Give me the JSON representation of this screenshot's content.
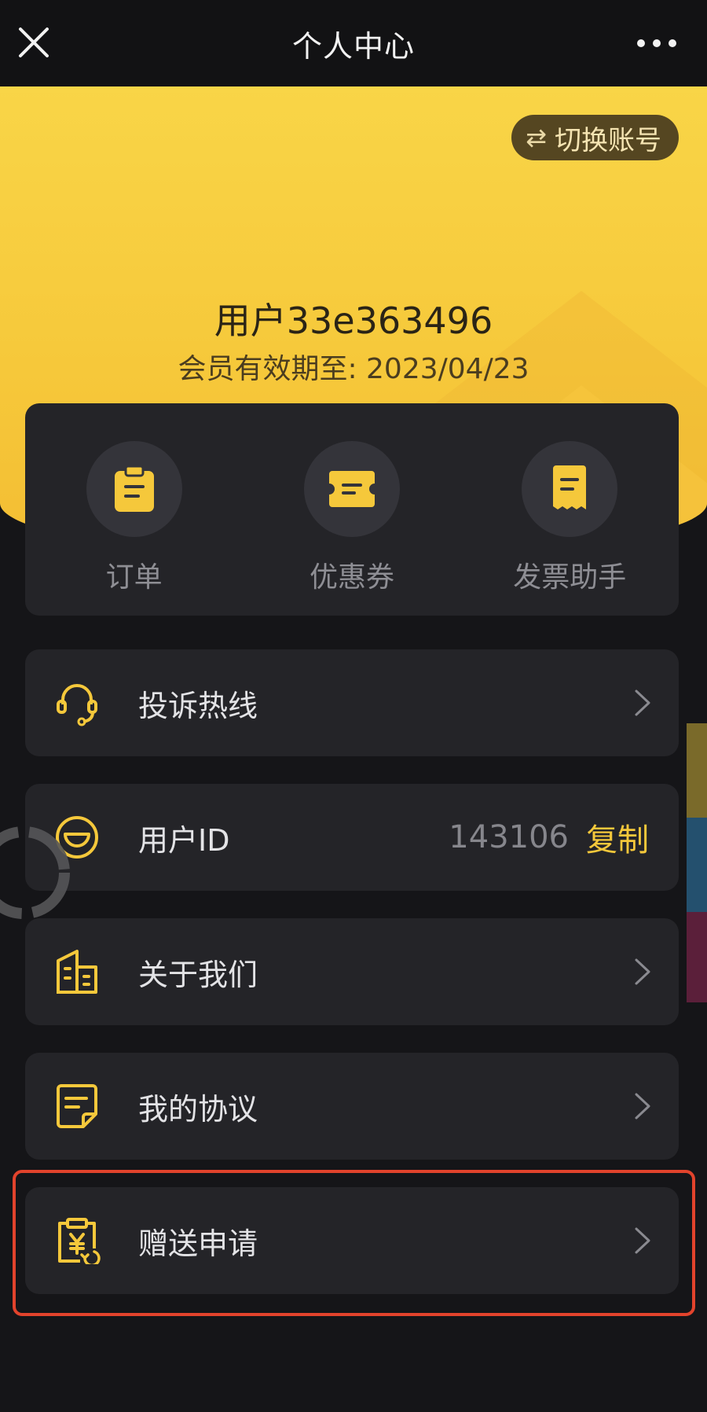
{
  "nav": {
    "title": "个人中心",
    "close_icon": "close-icon",
    "more_icon": "more-dots-icon"
  },
  "header": {
    "switch_account": "切换账号",
    "switch_icon": "swap-arrows-icon",
    "user_name": "用户33e363496",
    "member_expiry": "会员有效期至: 2023/04/23"
  },
  "shortcuts": [
    {
      "label": "订单",
      "icon": "order-clipboard-icon"
    },
    {
      "label": "优惠券",
      "icon": "coupon-ticket-icon"
    },
    {
      "label": "发票助手",
      "icon": "invoice-receipt-icon"
    }
  ],
  "menu": [
    {
      "label": "投诉热线",
      "icon": "headset-icon"
    },
    {
      "label": "用户ID",
      "icon": "smile-face-icon",
      "value": "143106",
      "action": "复制"
    },
    {
      "label": "关于我们",
      "icon": "building-icon"
    },
    {
      "label": "我的协议",
      "icon": "agreement-note-icon"
    },
    {
      "label": "赠送申请",
      "icon": "yuan-clipboard-icon"
    }
  ],
  "colors": {
    "accent": "#f5c83b",
    "background": "#151518",
    "card": "#242428",
    "highlight": "#e2432c"
  }
}
